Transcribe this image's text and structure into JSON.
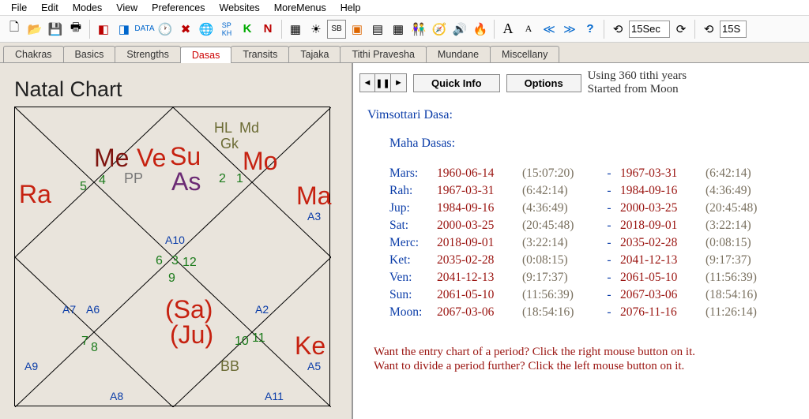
{
  "menu": [
    "File",
    "Edit",
    "Modes",
    "View",
    "Preferences",
    "Websites",
    "MoreMenus",
    "Help"
  ],
  "toolbar": {
    "timebox": "15Sec",
    "timebox2": "15S"
  },
  "tabs": [
    "Chakras",
    "Basics",
    "Strengths",
    "Dasas",
    "Transits",
    "Tajaka",
    "Tithi Pravesha",
    "Mundane",
    "Miscellany"
  ],
  "active_tab": "Dasas",
  "chart": {
    "title": "Natal Chart",
    "variant": "Rasi",
    "planets": {
      "Me": "Me",
      "Ve": "Ve",
      "Su": "Su",
      "As": "As",
      "Mo": "Mo",
      "Ra": "Ra",
      "Ma": "Ma",
      "Ke": "Ke",
      "Sa": "(Sa)",
      "Ju": "(Ju)"
    },
    "extras": {
      "HL": "HL",
      "Md": "Md",
      "Gk": "Gk",
      "BB": "BB",
      "PP": "PP"
    },
    "house_ids": {
      "h1": "1",
      "h2": "2",
      "h3": "3",
      "h4": "4",
      "h5": "5",
      "h6": "6",
      "h7": "7",
      "h8": "8",
      "h9": "9",
      "h10": "10",
      "h11": "11",
      "h12": "12"
    },
    "a_labels": {
      "A2": "A2",
      "A3": "A3",
      "A5": "A5",
      "A6": "A6",
      "A7": "A7",
      "A8": "A8",
      "A9": "A9",
      "A10": "A10",
      "A11": "A11"
    }
  },
  "right": {
    "quickinfo": "Quick Info",
    "options": "Options",
    "meta1": "Using 360 tithi years",
    "meta2": "Started from Moon",
    "section": "Vimsottari Dasa:",
    "sub": "Maha Dasas:",
    "rows": [
      {
        "pl": "Mars:",
        "d1": "1960-06-14",
        "t1": "(15:07:20)",
        "d2": "1967-03-31",
        "t2": "(6:42:14)"
      },
      {
        "pl": "Rah:",
        "d1": "1967-03-31",
        "t1": "(6:42:14)",
        "d2": "1984-09-16",
        "t2": "(4:36:49)"
      },
      {
        "pl": "Jup:",
        "d1": "1984-09-16",
        "t1": "(4:36:49)",
        "d2": "2000-03-25",
        "t2": "(20:45:48)"
      },
      {
        "pl": "Sat:",
        "d1": "2000-03-25",
        "t1": "(20:45:48)",
        "d2": "2018-09-01",
        "t2": "(3:22:14)"
      },
      {
        "pl": "Merc:",
        "d1": "2018-09-01",
        "t1": "(3:22:14)",
        "d2": "2035-02-28",
        "t2": "(0:08:15)"
      },
      {
        "pl": "Ket:",
        "d1": "2035-02-28",
        "t1": "(0:08:15)",
        "d2": "2041-12-13",
        "t2": "(9:17:37)"
      },
      {
        "pl": "Ven:",
        "d1": "2041-12-13",
        "t1": "(9:17:37)",
        "d2": "2061-05-10",
        "t2": "(11:56:39)"
      },
      {
        "pl": "Sun:",
        "d1": "2061-05-10",
        "t1": "(11:56:39)",
        "d2": "2067-03-06",
        "t2": "(18:54:16)"
      },
      {
        "pl": "Moon:",
        "d1": "2067-03-06",
        "t1": "(18:54:16)",
        "d2": "2076-11-16",
        "t2": "(11:26:14)"
      }
    ],
    "hint1": "Want the entry chart of a period? Click the right mouse button on it.",
    "hint2": "Want to divide a period further? Click the left mouse button on it."
  }
}
